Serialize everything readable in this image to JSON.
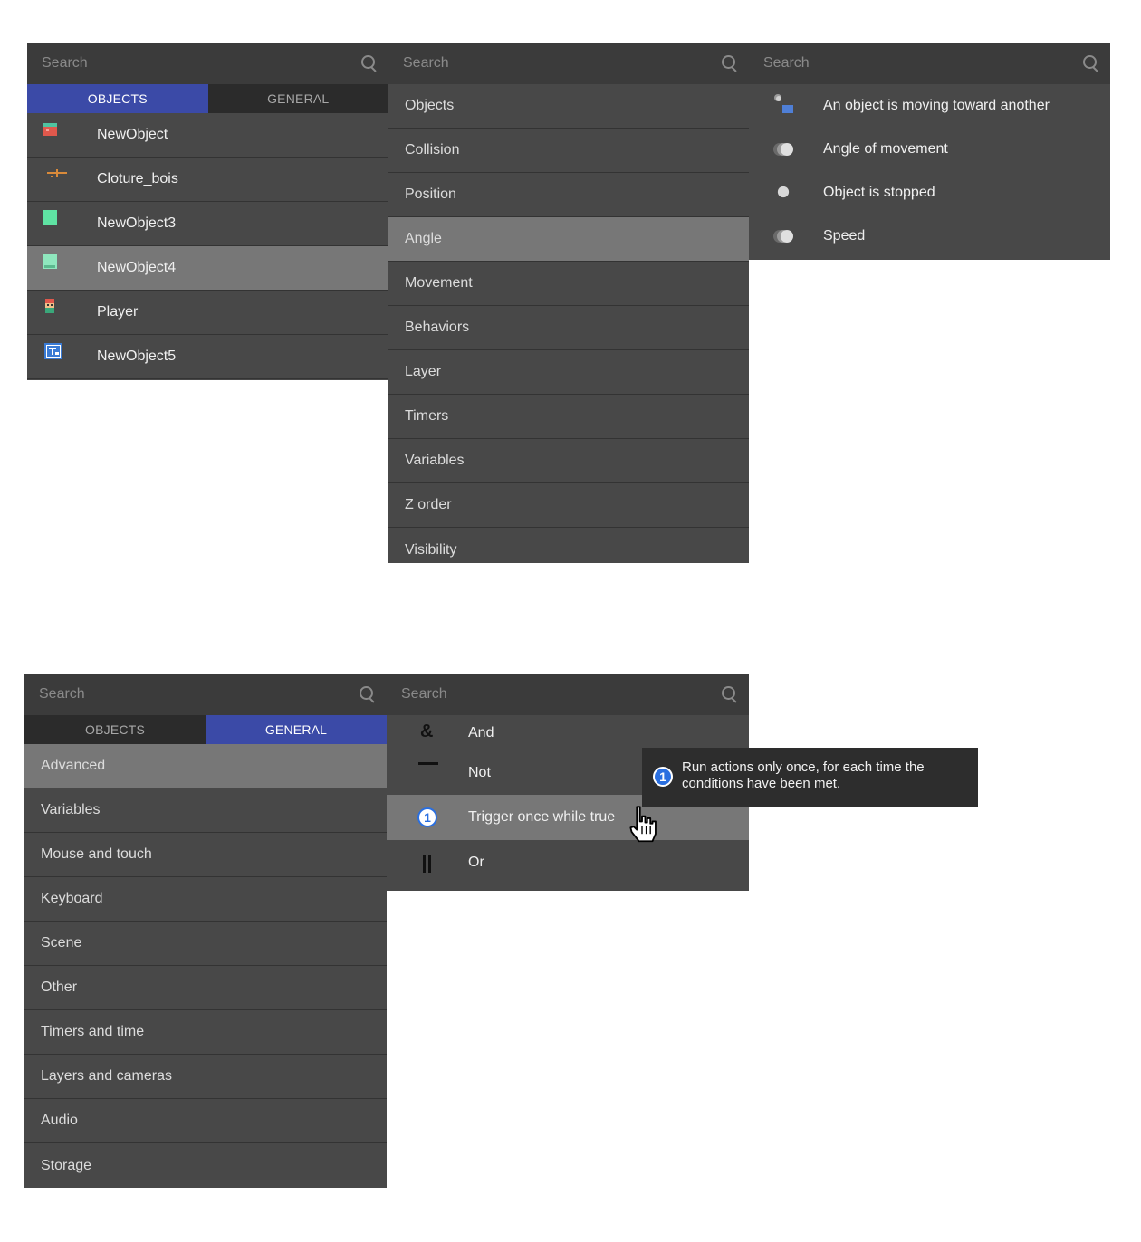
{
  "search_placeholder": "Search",
  "top_objects_panel": {
    "tabs": [
      {
        "label": "OBJECTS",
        "active": true
      },
      {
        "label": "GENERAL",
        "active": false
      }
    ],
    "items": [
      {
        "label": "NewObject",
        "icon": "red-sprite-icon",
        "selected": false
      },
      {
        "label": "Cloture_bois",
        "icon": "fence-icon",
        "selected": false
      },
      {
        "label": "NewObject3",
        "icon": "green-square-icon",
        "selected": false
      },
      {
        "label": "NewObject4",
        "icon": "green-tile-icon",
        "selected": true
      },
      {
        "label": "Player",
        "icon": "player-sprite-icon",
        "selected": false
      },
      {
        "label": "NewObject5",
        "icon": "text-object-icon",
        "selected": false
      }
    ]
  },
  "top_categories_panel": {
    "items": [
      {
        "label": "Objects",
        "selected": false
      },
      {
        "label": "Collision",
        "selected": false
      },
      {
        "label": "Position",
        "selected": false
      },
      {
        "label": "Angle",
        "selected": true
      },
      {
        "label": "Movement",
        "selected": false
      },
      {
        "label": "Behaviors",
        "selected": false
      },
      {
        "label": "Layer",
        "selected": false
      },
      {
        "label": "Timers",
        "selected": false
      },
      {
        "label": "Variables",
        "selected": false
      },
      {
        "label": "Z order",
        "selected": false
      },
      {
        "label": "Visibility",
        "selected": false
      }
    ]
  },
  "top_conditions_panel": {
    "items": [
      {
        "label": "An object is moving toward another",
        "icon": "moving-toward-icon"
      },
      {
        "label": "Angle of movement",
        "icon": "motion-ball-icon"
      },
      {
        "label": "Object is stopped",
        "icon": "stopped-ball-icon"
      },
      {
        "label": "Speed",
        "icon": "speed-ball-icon"
      }
    ]
  },
  "bottom_general_panel": {
    "tabs": [
      {
        "label": "OBJECTS",
        "active": false
      },
      {
        "label": "GENERAL",
        "active": true
      }
    ],
    "items": [
      {
        "label": "Advanced",
        "selected": true
      },
      {
        "label": "Variables",
        "selected": false
      },
      {
        "label": "Mouse and touch",
        "selected": false
      },
      {
        "label": "Keyboard",
        "selected": false
      },
      {
        "label": "Scene",
        "selected": false
      },
      {
        "label": "Other",
        "selected": false
      },
      {
        "label": "Timers and time",
        "selected": false
      },
      {
        "label": "Layers and cameras",
        "selected": false
      },
      {
        "label": "Audio",
        "selected": false
      },
      {
        "label": "Storage",
        "selected": false
      }
    ]
  },
  "bottom_advanced_panel": {
    "items": [
      {
        "label": "And",
        "icon": "ampersand-icon",
        "glyph": "&"
      },
      {
        "label": "Not",
        "icon": "minus-icon"
      },
      {
        "label": "Trigger once while true",
        "icon": "trigger-once-icon",
        "glyph": "1",
        "selected": true
      },
      {
        "label": "Or",
        "icon": "or-bars-icon"
      }
    ]
  },
  "tooltip": {
    "icon": "trigger-once-icon",
    "glyph": "1",
    "text_line1": "Run actions only once, for each time the",
    "text_line2": "conditions have been met."
  }
}
